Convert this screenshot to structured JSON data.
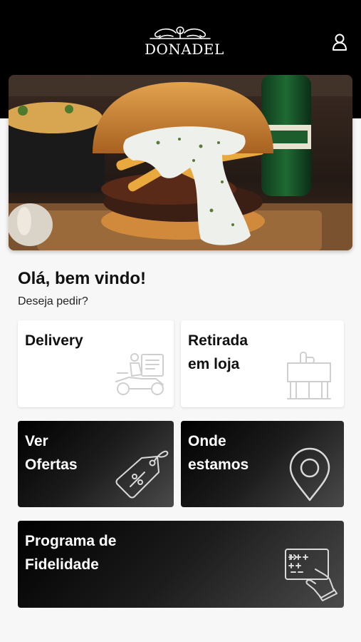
{
  "header": {
    "logo_text": "DONADEL",
    "logo_icon": "ornament-crest-icon",
    "user_icon": "user-icon",
    "background": "#000000"
  },
  "hero": {
    "image": "burger-photo-with-fries-and-beer"
  },
  "welcome": {
    "title": "Olá, bem vindo!",
    "subtitle": "Deseja pedir?"
  },
  "options": {
    "delivery": {
      "label": "Delivery",
      "icon": "delivery-scooter-icon"
    },
    "pickup": {
      "label": "Retirada\nem loja",
      "icon": "store-pickup-icon"
    },
    "offers": {
      "label": "Ver\nOfertas",
      "icon": "discount-tag-icon"
    },
    "location": {
      "label": "Onde\nestamos",
      "icon": "location-pin-icon"
    },
    "loyalty": {
      "label": "Programa de\nFidelidade",
      "icon": "loyalty-card-icon"
    }
  },
  "colors": {
    "page_background": "#f7f7f7",
    "dark_card_start": "#000000",
    "dark_card_end": "#4a4a4a",
    "light_card": "#ffffff",
    "icon_light": "#cfcfcf",
    "icon_dark": "#d9d9d9"
  }
}
